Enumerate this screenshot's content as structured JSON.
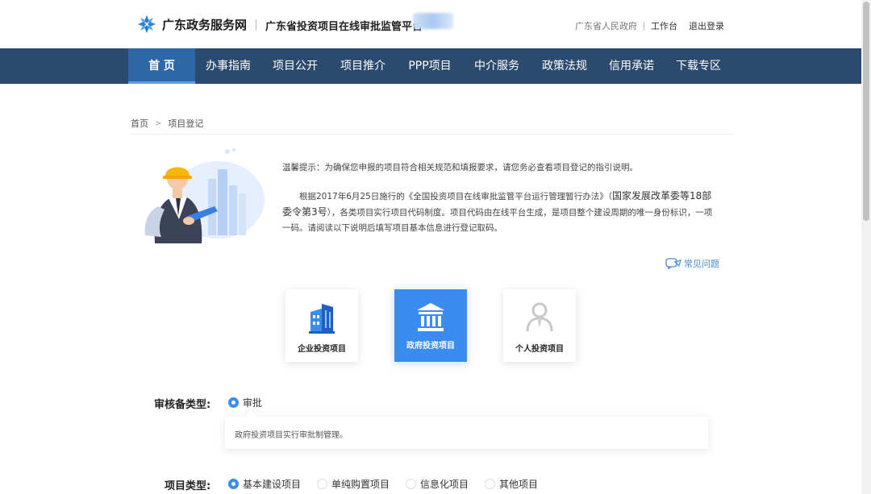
{
  "header": {
    "site_title": "广东政务服务网",
    "platform_title": "广东省投资项目在线审批监管平台",
    "gov_link": "广东省人民政府",
    "workbench": "工作台",
    "logout": "退出登录"
  },
  "nav": {
    "items": [
      {
        "label": "首 页",
        "active": true
      },
      {
        "label": "办事指南"
      },
      {
        "label": "项目公开"
      },
      {
        "label": "项目推介"
      },
      {
        "label": "PPP项目"
      },
      {
        "label": "中介服务"
      },
      {
        "label": "政策法规"
      },
      {
        "label": "信用承诺"
      },
      {
        "label": "下载专区"
      }
    ]
  },
  "breadcrumb": {
    "home": "首页",
    "arrow": ">",
    "current": "项目登记"
  },
  "notice": {
    "tip": "温馨提示：为确保您申报的项目符合相关规范和填报要求，请您务必查看项目登记的指引说明。",
    "body_a": "根据2017年6月25日施行的《全国投资项目在线审批监管平台运行管理暂行办法》（",
    "body_big": "国家发展改革委等18部委令第3号",
    "body_b": "），各类项目实行项目代码制度。项目代码由在线平台生成，是项目整个建设周期的唯一身份标识，一项一码。请阅读以下说明后填写项目基本信息进行登记取码。",
    "faq": "常见问题"
  },
  "cards": [
    {
      "label": "企业投资项目",
      "icon": "building-icon"
    },
    {
      "label": "政府投资项目",
      "icon": "government-icon",
      "active": true
    },
    {
      "label": "个人投资项目",
      "icon": "person-icon"
    }
  ],
  "form": {
    "review_label": "审核备类型:",
    "review_option": "审批",
    "review_tip": "政府投资项目实行审批制管理。",
    "project_label": "项目类型:",
    "project_options": [
      "基本建设项目",
      "单纯购置项目",
      "信息化项目",
      "其他项目"
    ]
  },
  "colors": {
    "nav_bg": "#2b4a6e",
    "nav_active": "#2e66a8",
    "accent": "#3b8cf0",
    "link": "#4a8ad6"
  }
}
